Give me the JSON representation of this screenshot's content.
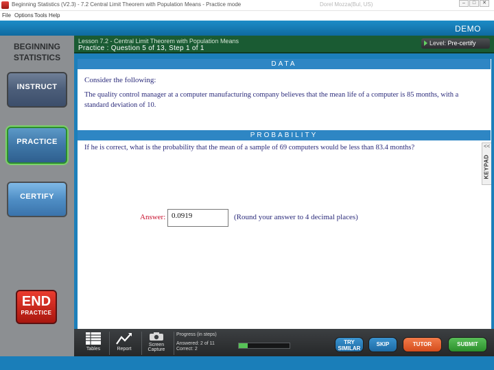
{
  "window": {
    "title": "Beginning Statistics (V2.3) - 7.2 Central Limit Theorem with Population Means - Practice mode",
    "user_text": "Dorel Mozza(Bul, US)",
    "minimize": "–",
    "maximize": "□",
    "close": "✕"
  },
  "menu": [
    "File",
    "Options",
    "Tools",
    "Help"
  ],
  "header": {
    "demo": "DEMO"
  },
  "sidebar": {
    "brand_line1": "BEGINNING",
    "brand_line2": "STATISTICS",
    "instruct": "INSTRUCT",
    "practice": "PRACTICE",
    "certify": "CERTIFY",
    "end_label": "END",
    "end_sub": "PRACTICE"
  },
  "lesson": {
    "title": "Lesson 7.2 - Central Limit Theorem with Population Means",
    "question_info": "Practice : Question 5 of 13, Step 1 of 1",
    "level_label": "Level:",
    "level_value": "Pre-certify"
  },
  "data_section": {
    "header": "DATA",
    "consider": "Consider the following:",
    "text": "The quality control manager at a computer manufacturing company believes that the mean life of a computer is 85 months, with a standard deviation of 10."
  },
  "probability_section": {
    "header": "PROBABILITY",
    "question": "If he is correct, what is the probability that the mean of a sample of 69 computers would be less than 83.4 months?",
    "answer_label": "Answer:",
    "answer_value": "0.0919",
    "hint": "(Round your answer to 4 decimal places)"
  },
  "keypad": {
    "label": "KEYPAD",
    "chevron": "<<"
  },
  "toolbar": {
    "tables": "Tables",
    "report": "Report",
    "capture_line1": "Screen",
    "capture_line2": "Capture",
    "progress_title": "Progress (in steps)",
    "answered": "Answered:  2 of 11",
    "correct": "Correct:     2",
    "progress_fraction": 0.18
  },
  "actions": {
    "try_line1": "TRY",
    "try_line2": "SIMILAR",
    "skip": "SKIP",
    "tutor": "TUTOR",
    "submit": "SUBMIT"
  },
  "colors": {
    "header_blue": "#1c8cc7",
    "lesson_green": "#1a5b33",
    "section_blue": "#2e86c4",
    "answer_red": "#c8102e",
    "progress_green": "#57c257"
  }
}
